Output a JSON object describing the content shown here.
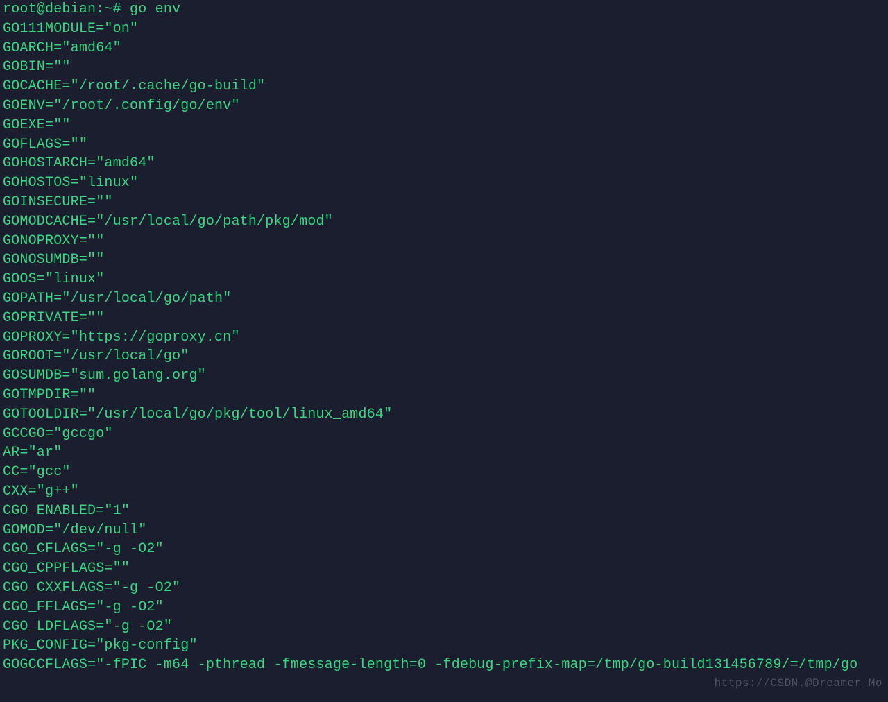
{
  "terminal": {
    "prompt": "root@debian:~# ",
    "command": "go env",
    "lines": [
      "GO111MODULE=\"on\"",
      "GOARCH=\"amd64\"",
      "GOBIN=\"\"",
      "GOCACHE=\"/root/.cache/go-build\"",
      "GOENV=\"/root/.config/go/env\"",
      "GOEXE=\"\"",
      "GOFLAGS=\"\"",
      "GOHOSTARCH=\"amd64\"",
      "GOHOSTOS=\"linux\"",
      "GOINSECURE=\"\"",
      "GOMODCACHE=\"/usr/local/go/path/pkg/mod\"",
      "GONOPROXY=\"\"",
      "GONOSUMDB=\"\"",
      "GOOS=\"linux\"",
      "GOPATH=\"/usr/local/go/path\"",
      "GOPRIVATE=\"\"",
      "GOPROXY=\"https://goproxy.cn\"",
      "GOROOT=\"/usr/local/go\"",
      "GOSUMDB=\"sum.golang.org\"",
      "GOTMPDIR=\"\"",
      "GOTOOLDIR=\"/usr/local/go/pkg/tool/linux_amd64\"",
      "GCCGO=\"gccgo\"",
      "AR=\"ar\"",
      "CC=\"gcc\"",
      "CXX=\"g++\"",
      "CGO_ENABLED=\"1\"",
      "GOMOD=\"/dev/null\"",
      "CGO_CFLAGS=\"-g -O2\"",
      "CGO_CPPFLAGS=\"\"",
      "CGO_CXXFLAGS=\"-g -O2\"",
      "CGO_FFLAGS=\"-g -O2\"",
      "CGO_LDFLAGS=\"-g -O2\"",
      "PKG_CONFIG=\"pkg-config\"",
      "GOGCCFLAGS=\"-fPIC -m64 -pthread -fmessage-length=0 -fdebug-prefix-map=/tmp/go-build131456789/=/tmp/go"
    ],
    "watermark": "https://CSDN.@Dreamer_Mo"
  }
}
